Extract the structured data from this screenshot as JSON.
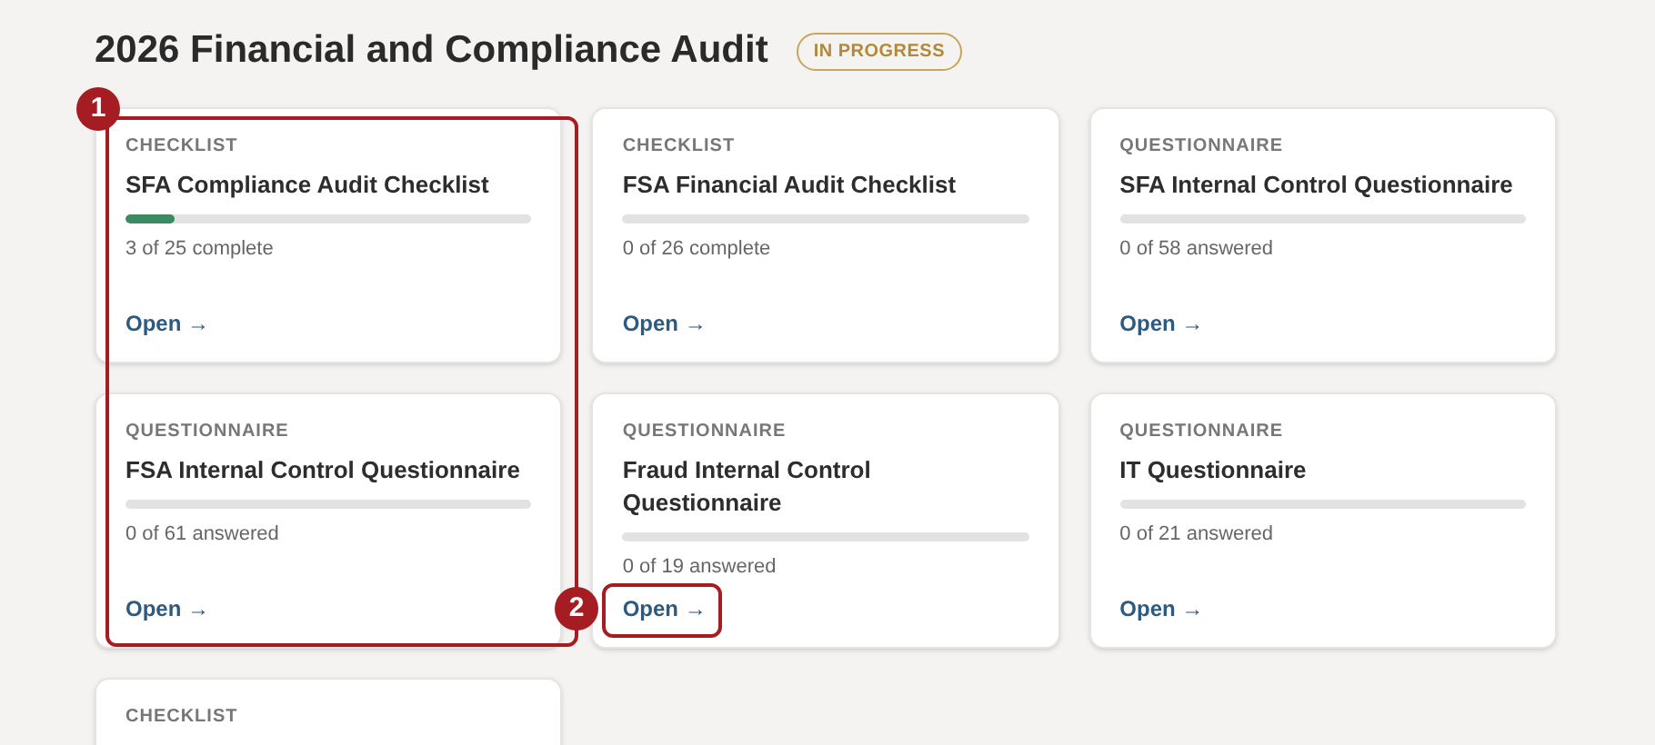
{
  "page": {
    "title": "2026 Financial and Compliance Audit",
    "status": "IN PROGRESS"
  },
  "cards": [
    {
      "type": "CHECKLIST",
      "title": "SFA Compliance Audit Checklist",
      "level": 0.12,
      "progress": "3 of 25 complete",
      "link": "Open →"
    },
    {
      "type": "CHECKLIST",
      "title": "FSA Financial Audit Checklist",
      "level": 0,
      "progress": "0 of 26 complete",
      "link": "Open →"
    },
    {
      "type": "QUESTIONNAIRE",
      "title": "SFA Internal Control Questionnaire",
      "level": 0,
      "progress": "0 of 58 answered",
      "link": "Open →"
    },
    {
      "type": "QUESTIONNAIRE",
      "title": "FSA Internal Control Questionnaire",
      "level": 0,
      "progress": "0 of 61 answered",
      "link": "Open →"
    },
    {
      "type": "QUESTIONNAIRE",
      "title": "Fraud Internal Control Questionnaire",
      "level": 0,
      "progress": "0 of 19 answered",
      "link": "Open →"
    },
    {
      "type": "QUESTIONNAIRE",
      "title": "IT Questionnaire",
      "level": 0,
      "progress": "0 of 21 answered",
      "link": "Open →"
    },
    {
      "type": "CHECKLIST"
    }
  ],
  "annotations": [
    {
      "label": "1"
    },
    {
      "label": "2"
    }
  ]
}
